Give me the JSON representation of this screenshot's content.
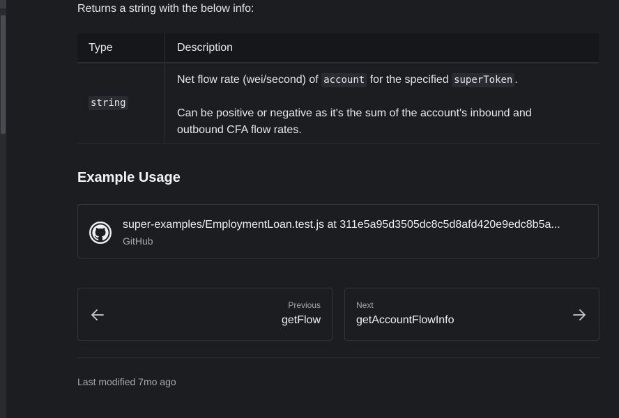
{
  "intro": "Returns a string with the below info:",
  "table": {
    "headers": {
      "type": "Type",
      "description": "Description"
    },
    "row": {
      "type": "string",
      "desc_line1_pre": "Net flow rate (wei/second) of ",
      "desc_code1": "account",
      "desc_line1_mid": " for the specified ",
      "desc_code2": "superToken",
      "desc_line1_post": ".",
      "desc_para2": "Can be positive or negative as it's the sum of the account's inbound and outbound CFA flow rates."
    }
  },
  "example": {
    "heading": "Example Usage",
    "card": {
      "title": "super-examples/EmploymentLoan.test.js at 311e5a95d3505dc8c5d8afd420e9edc8b5a...",
      "subtitle": "GitHub",
      "icon": "github-icon"
    }
  },
  "nav": {
    "previous": {
      "label": "Previous",
      "title": "getFlow",
      "icon": "arrow-left-icon"
    },
    "next": {
      "label": "Next",
      "title": "getAccountFlowInfo",
      "icon": "arrow-right-icon"
    }
  },
  "footer": {
    "modified": "Last modified 7mo ago"
  }
}
